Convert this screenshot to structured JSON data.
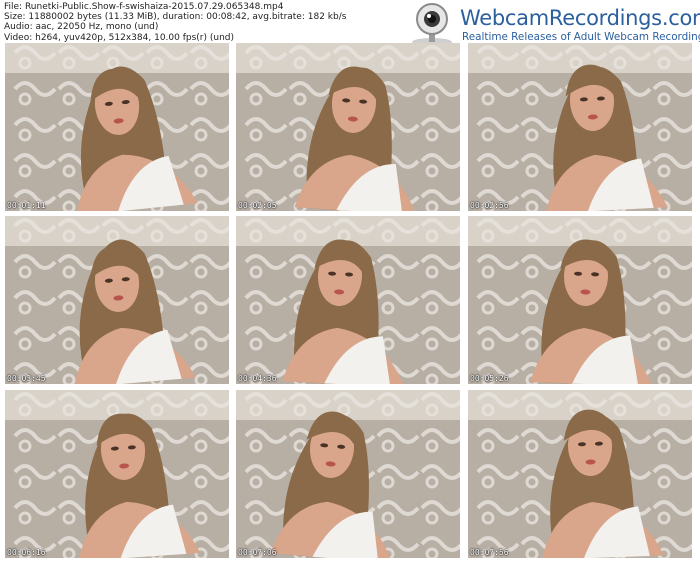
{
  "info": {
    "file": "File: Runetki-Public.Show-f-swishaiza-2015.07.29.065348.mp4",
    "size": "Size: 11880002 bytes (11.33 MiB), duration: 00:08:42, avg.bitrate: 182 kb/s",
    "audio": "Audio: aac, 22050 Hz, mono (und)",
    "video": "Video: h264, yuv420p, 512x384, 10.00 fps(r) (und)"
  },
  "brand": {
    "name": "WebcamRecordings.com",
    "tagline": "Realtime Releases of Adult Webcam Recordings",
    "icon": "webcam-icon"
  },
  "thumbnails": [
    {
      "timestamp": "00:01:11"
    },
    {
      "timestamp": "00:02:05"
    },
    {
      "timestamp": "00:02:56"
    },
    {
      "timestamp": "00:03:45"
    },
    {
      "timestamp": "00:04:36"
    },
    {
      "timestamp": "00:05:26"
    },
    {
      "timestamp": "00:06:16"
    },
    {
      "timestamp": "00:07:06"
    },
    {
      "timestamp": "00:07:56"
    }
  ],
  "colors": {
    "brand_blue": "#2b5f9e",
    "backdrop": "#b7aea4",
    "hair": "#8a6a48",
    "skin": "#d9a58b",
    "top": "#f3f1ee"
  }
}
